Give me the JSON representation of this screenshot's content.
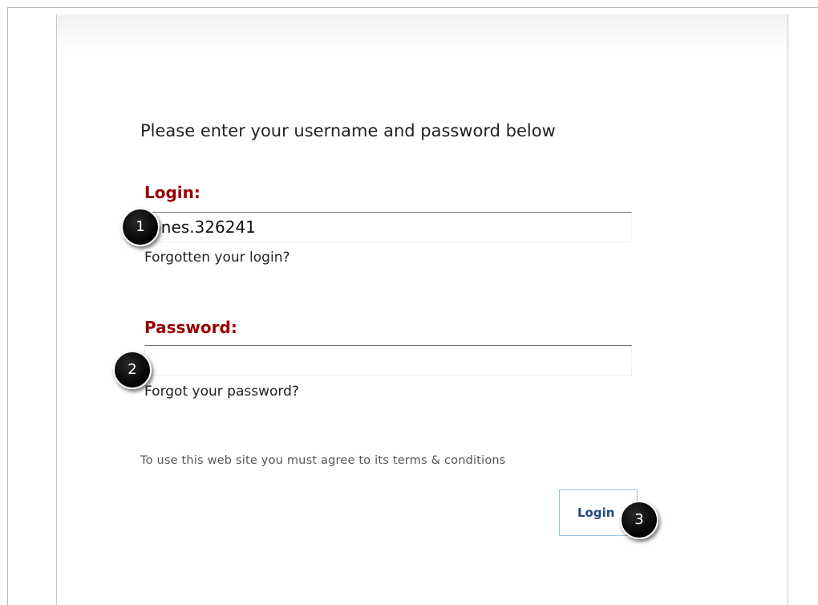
{
  "login_form": {
    "instructions": "Please enter your username and password below",
    "login_label": "Login:",
    "login_value": "jones.326241",
    "forgot_login": "Forgotten your login?",
    "password_label": "Password:",
    "password_value": "",
    "forgot_password": "Forgot your password?",
    "terms": "To use this web site you must agree to its terms & conditions",
    "login_button": "Login"
  },
  "step_markers": [
    "1",
    "2",
    "3"
  ],
  "colors": {
    "label": "#990000",
    "button_text": "#234a80",
    "button_border": "#9cc3e5",
    "marker": "#000000"
  }
}
